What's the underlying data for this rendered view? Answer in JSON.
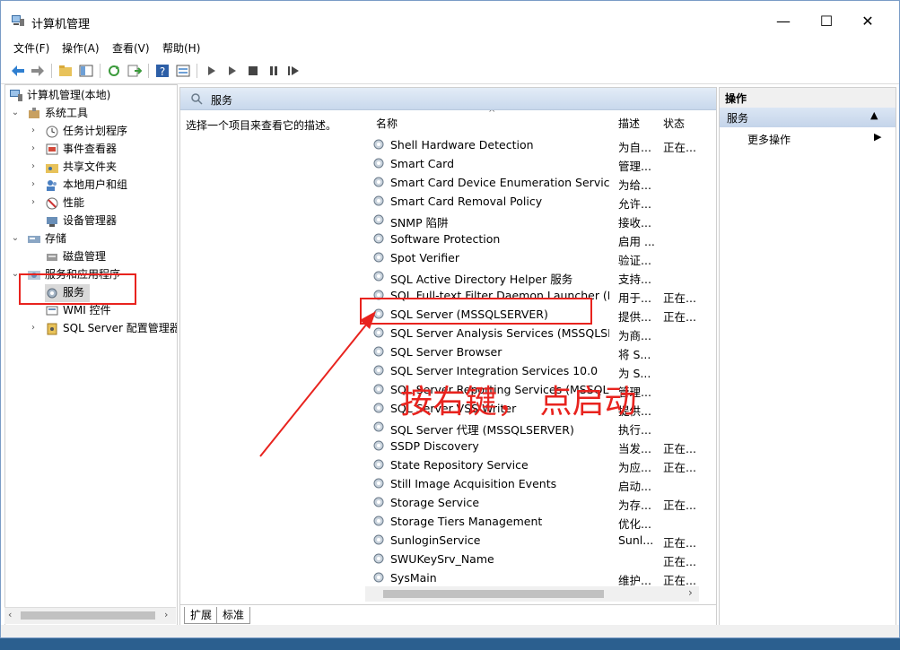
{
  "window": {
    "title": "计算机管理",
    "minimize": "—",
    "maximize": "☐",
    "close": "✕"
  },
  "menu": [
    "文件(F)",
    "操作(A)",
    "查看(V)",
    "帮助(H)"
  ],
  "tree": {
    "root": "计算机管理(本地)",
    "system_tools": "系统工具",
    "task_scheduler": "任务计划程序",
    "event_viewer": "事件查看器",
    "shared_folders": "共享文件夹",
    "local_users": "本地用户和组",
    "performance": "性能",
    "device_manager": "设备管理器",
    "storage": "存储",
    "disk_mgmt": "磁盘管理",
    "services_apps": "服务和应用程序",
    "services": "服务",
    "wmi": "WMI 控件",
    "sql_config": "SQL Server 配置管理器"
  },
  "center": {
    "header": "服务",
    "description": "选择一个项目来查看它的描述。",
    "columns": {
      "name": "名称",
      "desc": "描述",
      "status": "状态"
    },
    "rows": [
      {
        "name": "Shell Hardware Detection",
        "desc": "为自...",
        "status": "正在..."
      },
      {
        "name": "Smart Card",
        "desc": "管理...",
        "status": ""
      },
      {
        "name": "Smart Card Device Enumeration Service",
        "desc": "为给...",
        "status": ""
      },
      {
        "name": "Smart Card Removal Policy",
        "desc": "允许...",
        "status": ""
      },
      {
        "name": "SNMP 陷阱",
        "desc": "接收...",
        "status": ""
      },
      {
        "name": "Software Protection",
        "desc": "启用 ...",
        "status": ""
      },
      {
        "name": "Spot Verifier",
        "desc": "验证...",
        "status": ""
      },
      {
        "name": "SQL Active Directory Helper 服务",
        "desc": "支持...",
        "status": ""
      },
      {
        "name": "SQL Full-text Filter Daemon Launcher (M...",
        "desc": "用于...",
        "status": "正在..."
      },
      {
        "name": "SQL Server (MSSQLSERVER)",
        "desc": "提供...",
        "status": "正在..."
      },
      {
        "name": "SQL Server Analysis Services (MSSQLSER...",
        "desc": "为商...",
        "status": ""
      },
      {
        "name": "SQL Server Browser",
        "desc": "将 S...",
        "status": ""
      },
      {
        "name": "SQL Server Integration Services 10.0",
        "desc": "为 S...",
        "status": ""
      },
      {
        "name": "SQL Server Reporting Services (MSSQLS...",
        "desc": "管理...",
        "status": ""
      },
      {
        "name": "SQL Server VSS Writer",
        "desc": "提供...",
        "status": ""
      },
      {
        "name": "SQL Server 代理 (MSSQLSERVER)",
        "desc": "执行...",
        "status": ""
      },
      {
        "name": "SSDP Discovery",
        "desc": "当发...",
        "status": "正在..."
      },
      {
        "name": "State Repository Service",
        "desc": "为应...",
        "status": "正在..."
      },
      {
        "name": "Still Image Acquisition Events",
        "desc": "启动...",
        "status": ""
      },
      {
        "name": "Storage Service",
        "desc": "为存...",
        "status": "正在..."
      },
      {
        "name": "Storage Tiers Management",
        "desc": "优化...",
        "status": ""
      },
      {
        "name": "SunloginService",
        "desc": "Sunl...",
        "status": "正在..."
      },
      {
        "name": "SWUKeySrv_Name",
        "desc": "",
        "status": "正在..."
      },
      {
        "name": "SysMain",
        "desc": "维护...",
        "status": "正在..."
      }
    ],
    "tabs": [
      "扩展",
      "标准"
    ]
  },
  "actions": {
    "header": "操作",
    "section": "服务",
    "more": "更多操作"
  },
  "annotation": {
    "text": "按右键， 点启动",
    "color": "#e8231e"
  }
}
